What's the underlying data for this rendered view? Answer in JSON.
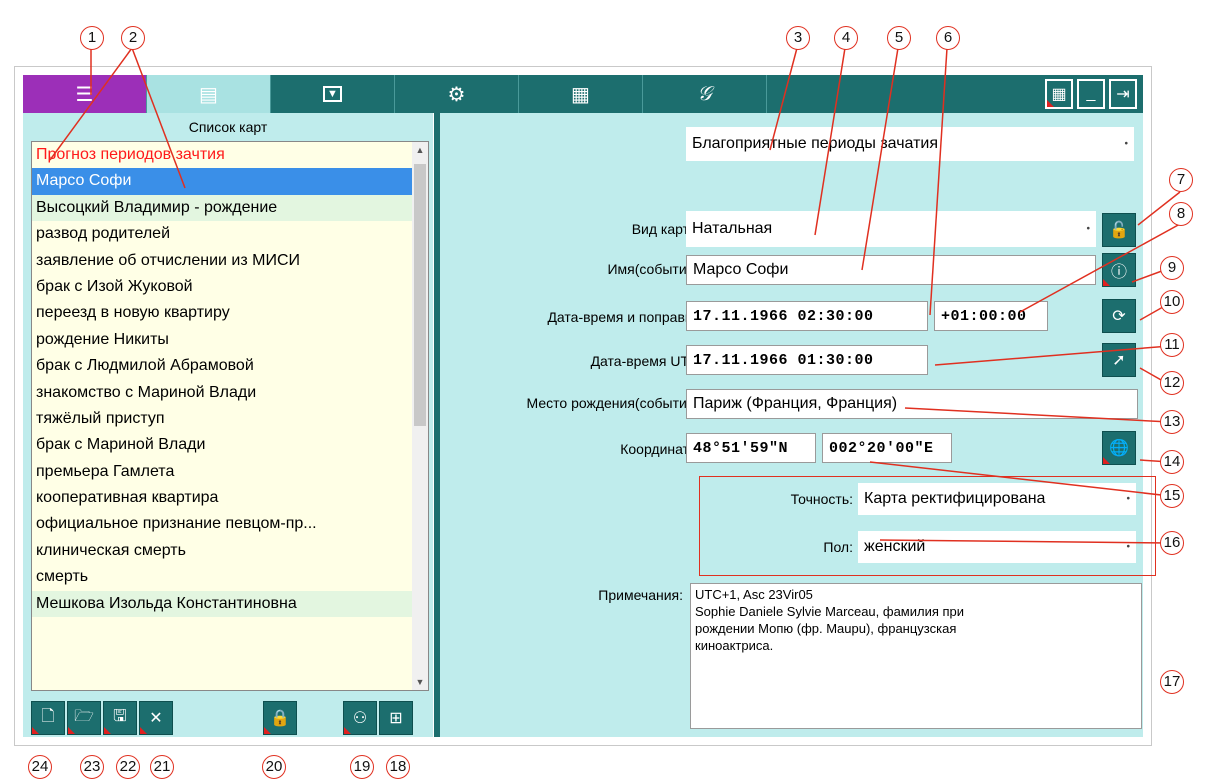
{
  "toolbar": {
    "tabs": [
      {
        "icon": "list-icon",
        "glyph": "☰"
      },
      {
        "icon": "grid-layout-icon",
        "glyph": "▤"
      },
      {
        "icon": "dropdown-box-icon",
        "glyph": "▼"
      },
      {
        "icon": "gear-icon",
        "glyph": "⚙"
      },
      {
        "icon": "calculator-icon",
        "glyph": "▦"
      },
      {
        "icon": "signature-icon",
        "glyph": "𝒢"
      }
    ],
    "window_buttons": [
      {
        "icon": "apps-grid-icon",
        "glyph": "▦"
      },
      {
        "icon": "minimize-icon",
        "glyph": "_"
      },
      {
        "icon": "exit-icon",
        "glyph": "⇥"
      }
    ]
  },
  "left": {
    "title": "Список карт",
    "items": [
      "Прогноз периодов зачтия",
      "Марсо Софи",
      "Высоцкий Владимир - рождение",
      "развод родителей",
      "заявление об отчислении из МИСИ",
      "брак с Изой Жуковой",
      "переезд в новую квартиру",
      "рождение Никиты",
      "брак с Людмилой Абрамовой",
      "знакомство с Мариной Влади",
      "тяжёлый приступ",
      "брак с Мариной Влади",
      "премьера Гамлета",
      "кооперативная квартира",
      "официальное признание певцом-пр...",
      "клиническая смерть",
      "смерть",
      "Мешкова Изольда Константиновна"
    ]
  },
  "right": {
    "mode_value": "Благоприятные периоды зачатия",
    "chart_type_label": "Вид карты:",
    "chart_type_value": "Натальная",
    "name_label": "Имя(событие):",
    "name_value": "Марсо Софи",
    "datetime_label": "Дата-время и поправка:",
    "datetime_value": "17.11.1966 02:30:00",
    "offset_value": "+01:00:00",
    "utc_label": "Дата-время UTC:",
    "utc_value": "17.11.1966 01:30:00",
    "place_label": "Место рождения(события):",
    "place_value": "Париж (Франция, Франция)",
    "coords_label": "Координаты:",
    "lat_value": "48°51'59\"N",
    "lon_value": "002°20'00\"E",
    "accuracy_label": "Точность:",
    "accuracy_value": "Карта ректифицирована",
    "sex_label": "Пол:",
    "sex_value": "женский",
    "notes_label": "Примечания:",
    "notes_line1": "UTC+1, Asc 23Vir05",
    "notes_line2": "Sophie Daniele Sylvie Marceau, фамилия при",
    "notes_line3": "рождении Мопю (фр. Maupu), французская",
    "notes_line4": "киноактриса."
  },
  "callouts": [
    "1",
    "2",
    "3",
    "4",
    "5",
    "6",
    "7",
    "8",
    "9",
    "10",
    "11",
    "12",
    "13",
    "14",
    "15",
    "16",
    "17",
    "18",
    "19",
    "20",
    "21",
    "22",
    "23",
    "24"
  ]
}
